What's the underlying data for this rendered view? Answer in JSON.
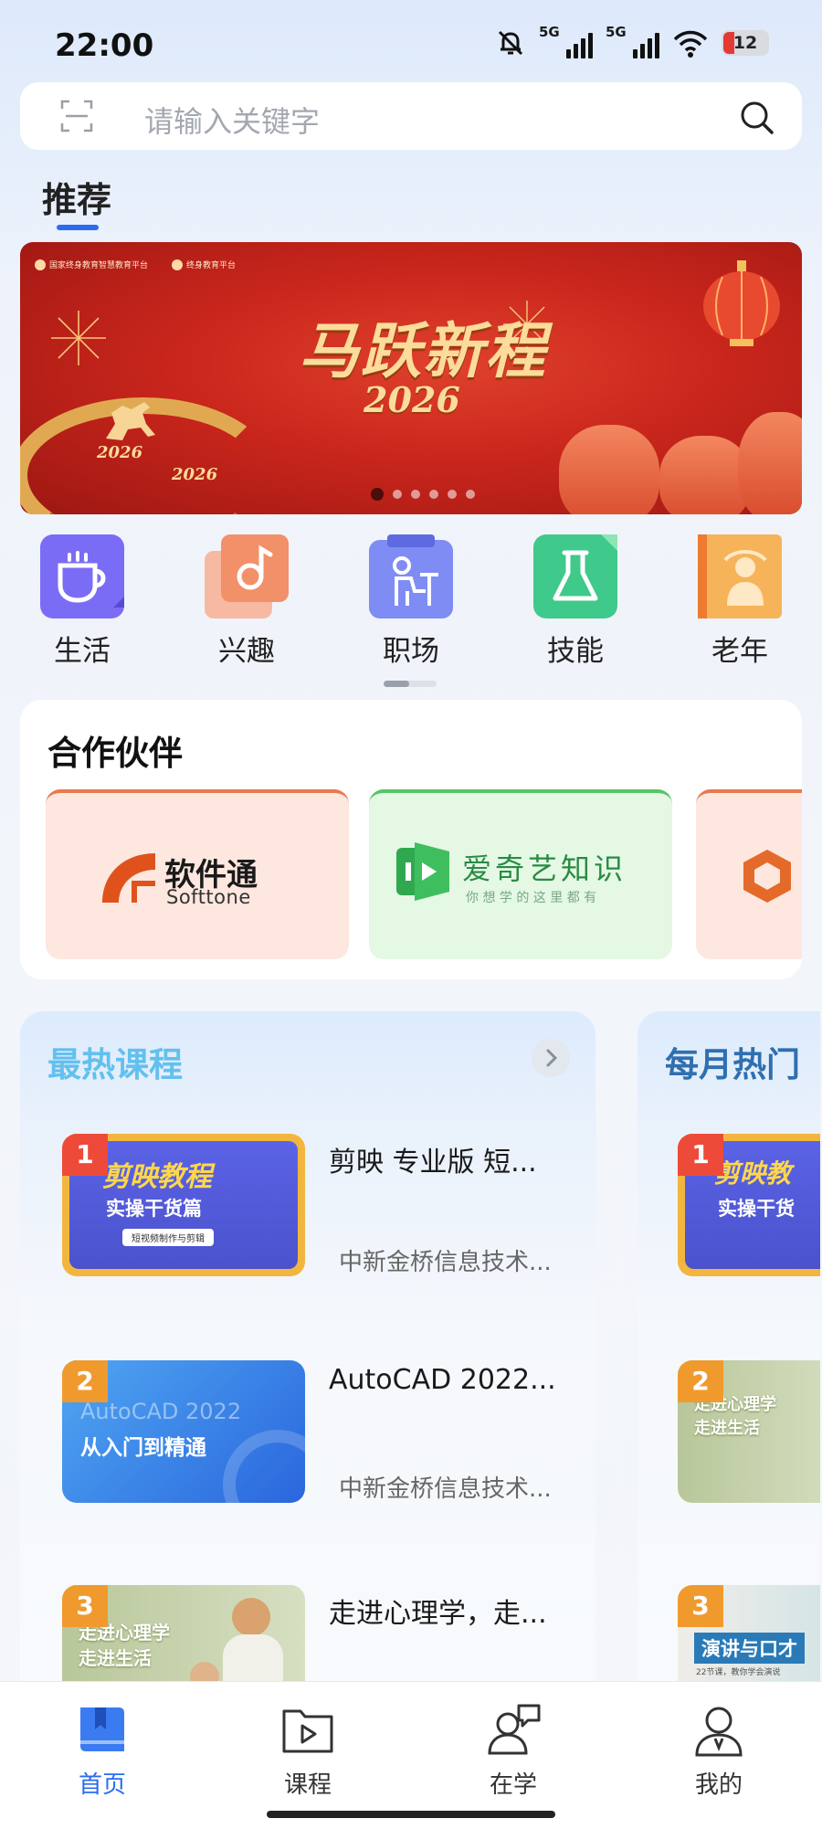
{
  "status_bar": {
    "time": "22:00",
    "network_1": "5G",
    "network_2": "5G",
    "battery": "12"
  },
  "search": {
    "placeholder": "请输入关键字"
  },
  "recommend": {
    "title": "推荐"
  },
  "banner": {
    "org_1": "国家终身教育智慧教育平台",
    "org_2": "终身教育平台",
    "headline": "马跃新程",
    "year": "2026",
    "tag_1": "2026",
    "tag_2": "2026",
    "pages": 6,
    "active_page": 1
  },
  "categories": [
    {
      "label": "生活",
      "icon": "coffee-cup-icon",
      "color": "#7b6cf6"
    },
    {
      "label": "兴趣",
      "icon": "music-note-icon",
      "color": "#f2906a"
    },
    {
      "label": "职场",
      "icon": "office-worker-icon",
      "color": "#7f8cf4"
    },
    {
      "label": "技能",
      "icon": "flask-icon",
      "color": "#3fc98a"
    },
    {
      "label": "老年",
      "icon": "elder-icon",
      "color": "#f7a94b"
    }
  ],
  "partners": {
    "title": "合作伙伴",
    "items": [
      {
        "name": "软件通",
        "sub": "Softtone"
      },
      {
        "name": "爱奇艺知识",
        "sub": "你 想 学 的    这 里 都 有"
      },
      {
        "name": "",
        "sub": ""
      }
    ]
  },
  "hot_courses": {
    "title": "最热课程",
    "items": [
      {
        "rank": "1",
        "title": "剪映 专业版 短...",
        "org": "中新金桥信息技术...",
        "thumb_title": "剪映教程",
        "thumb_sub": "实操干货篇",
        "thumb_note": "短视频制作与剪辑"
      },
      {
        "rank": "2",
        "title": "AutoCAD 2022...",
        "org": "中新金桥信息技术...",
        "thumb_title": "AutoCAD 2022",
        "thumb_sub": "从入门到精通",
        "thumb_note": ""
      },
      {
        "rank": "3",
        "title": "走进心理学，走...",
        "org": "",
        "thumb_title": "走进心理学",
        "thumb_sub": "走进生活",
        "thumb_note": ""
      }
    ]
  },
  "monthly_courses": {
    "title": "每月热门",
    "items": [
      {
        "rank": "1",
        "thumb_title": "剪映教",
        "thumb_sub": "实操干货"
      },
      {
        "rank": "2",
        "thumb_title": "走进心理学",
        "thumb_sub": "走进生活"
      },
      {
        "rank": "3",
        "thumb_title": "演讲与口才",
        "thumb_sub": "22节课，教你学会演说"
      }
    ]
  },
  "tabbar": [
    {
      "label": "首页",
      "icon": "book-home-icon",
      "active": true
    },
    {
      "label": "课程",
      "icon": "video-folder-icon",
      "active": false
    },
    {
      "label": "在学",
      "icon": "learner-chat-icon",
      "active": false
    },
    {
      "label": "我的",
      "icon": "profile-icon",
      "active": false
    }
  ],
  "colors": {
    "accent": "#2a6cf0",
    "hot_title": "#63c0ee",
    "monthly_title": "#2f6fb0",
    "banner_red": "#c9261c"
  }
}
